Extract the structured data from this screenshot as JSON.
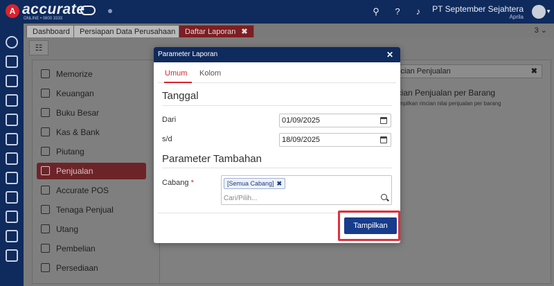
{
  "app": {
    "logo_mark": "A",
    "logo_text": "accurate",
    "logo_sub": "ONLINE • 0800 3333",
    "company": "PT September Sejahtera",
    "user": "Aprila"
  },
  "tabs": [
    {
      "label": "Dashboard"
    },
    {
      "label": "Persiapan Data Perusahaan"
    },
    {
      "label": "Daftar Laporan",
      "close": "✖"
    }
  ],
  "tab_count": "3 ⌄",
  "toolbar": {
    "list_icon": "☷"
  },
  "menu": [
    {
      "label": "Memorize",
      "icon": "save-icon"
    },
    {
      "label": "Keuangan",
      "icon": "money-icon"
    },
    {
      "label": "Buku Besar",
      "icon": "book-icon"
    },
    {
      "label": "Kas & Bank",
      "icon": "bank-icon"
    },
    {
      "label": "Piutang",
      "icon": "receivable-icon"
    },
    {
      "label": "Penjualan",
      "icon": "cart-icon"
    },
    {
      "label": "Accurate POS",
      "icon": "pos-icon"
    },
    {
      "label": "Tenaga Penjual",
      "icon": "salesperson-icon"
    },
    {
      "label": "Utang",
      "icon": "payable-icon"
    },
    {
      "label": "Pembelian",
      "icon": "purchase-icon"
    },
    {
      "label": "Persediaan",
      "icon": "inventory-icon"
    }
  ],
  "report_panel": {
    "search_value": "incian Penjualan",
    "search_clear": "✖",
    "report_title": "ncian Penjualan per Barang",
    "report_desc": "nampilkan rincian nilai penjualan per barang"
  },
  "dialog": {
    "title": "Parameter Laporan",
    "close": "✕",
    "tabs": [
      "Umum",
      "Kolom"
    ],
    "section_date": "Tanggal",
    "from_label": "Dari",
    "from_value": "01/09/2025",
    "to_label": "s/d",
    "to_value": "18/09/2025",
    "section_extra": "Parameter Tambahan",
    "branch_label": "Cabang",
    "required_mark": "*",
    "branch_chip": "[Semua Cabang]",
    "chip_remove": "✖",
    "branch_placeholder": "Cari/Pilih...",
    "show_button": "Tampilkan"
  },
  "colors": {
    "navy": "#0f2a5c",
    "accent_red": "#d9232e",
    "button_blue": "#173c8c",
    "highlight_red": "#e0303c"
  }
}
